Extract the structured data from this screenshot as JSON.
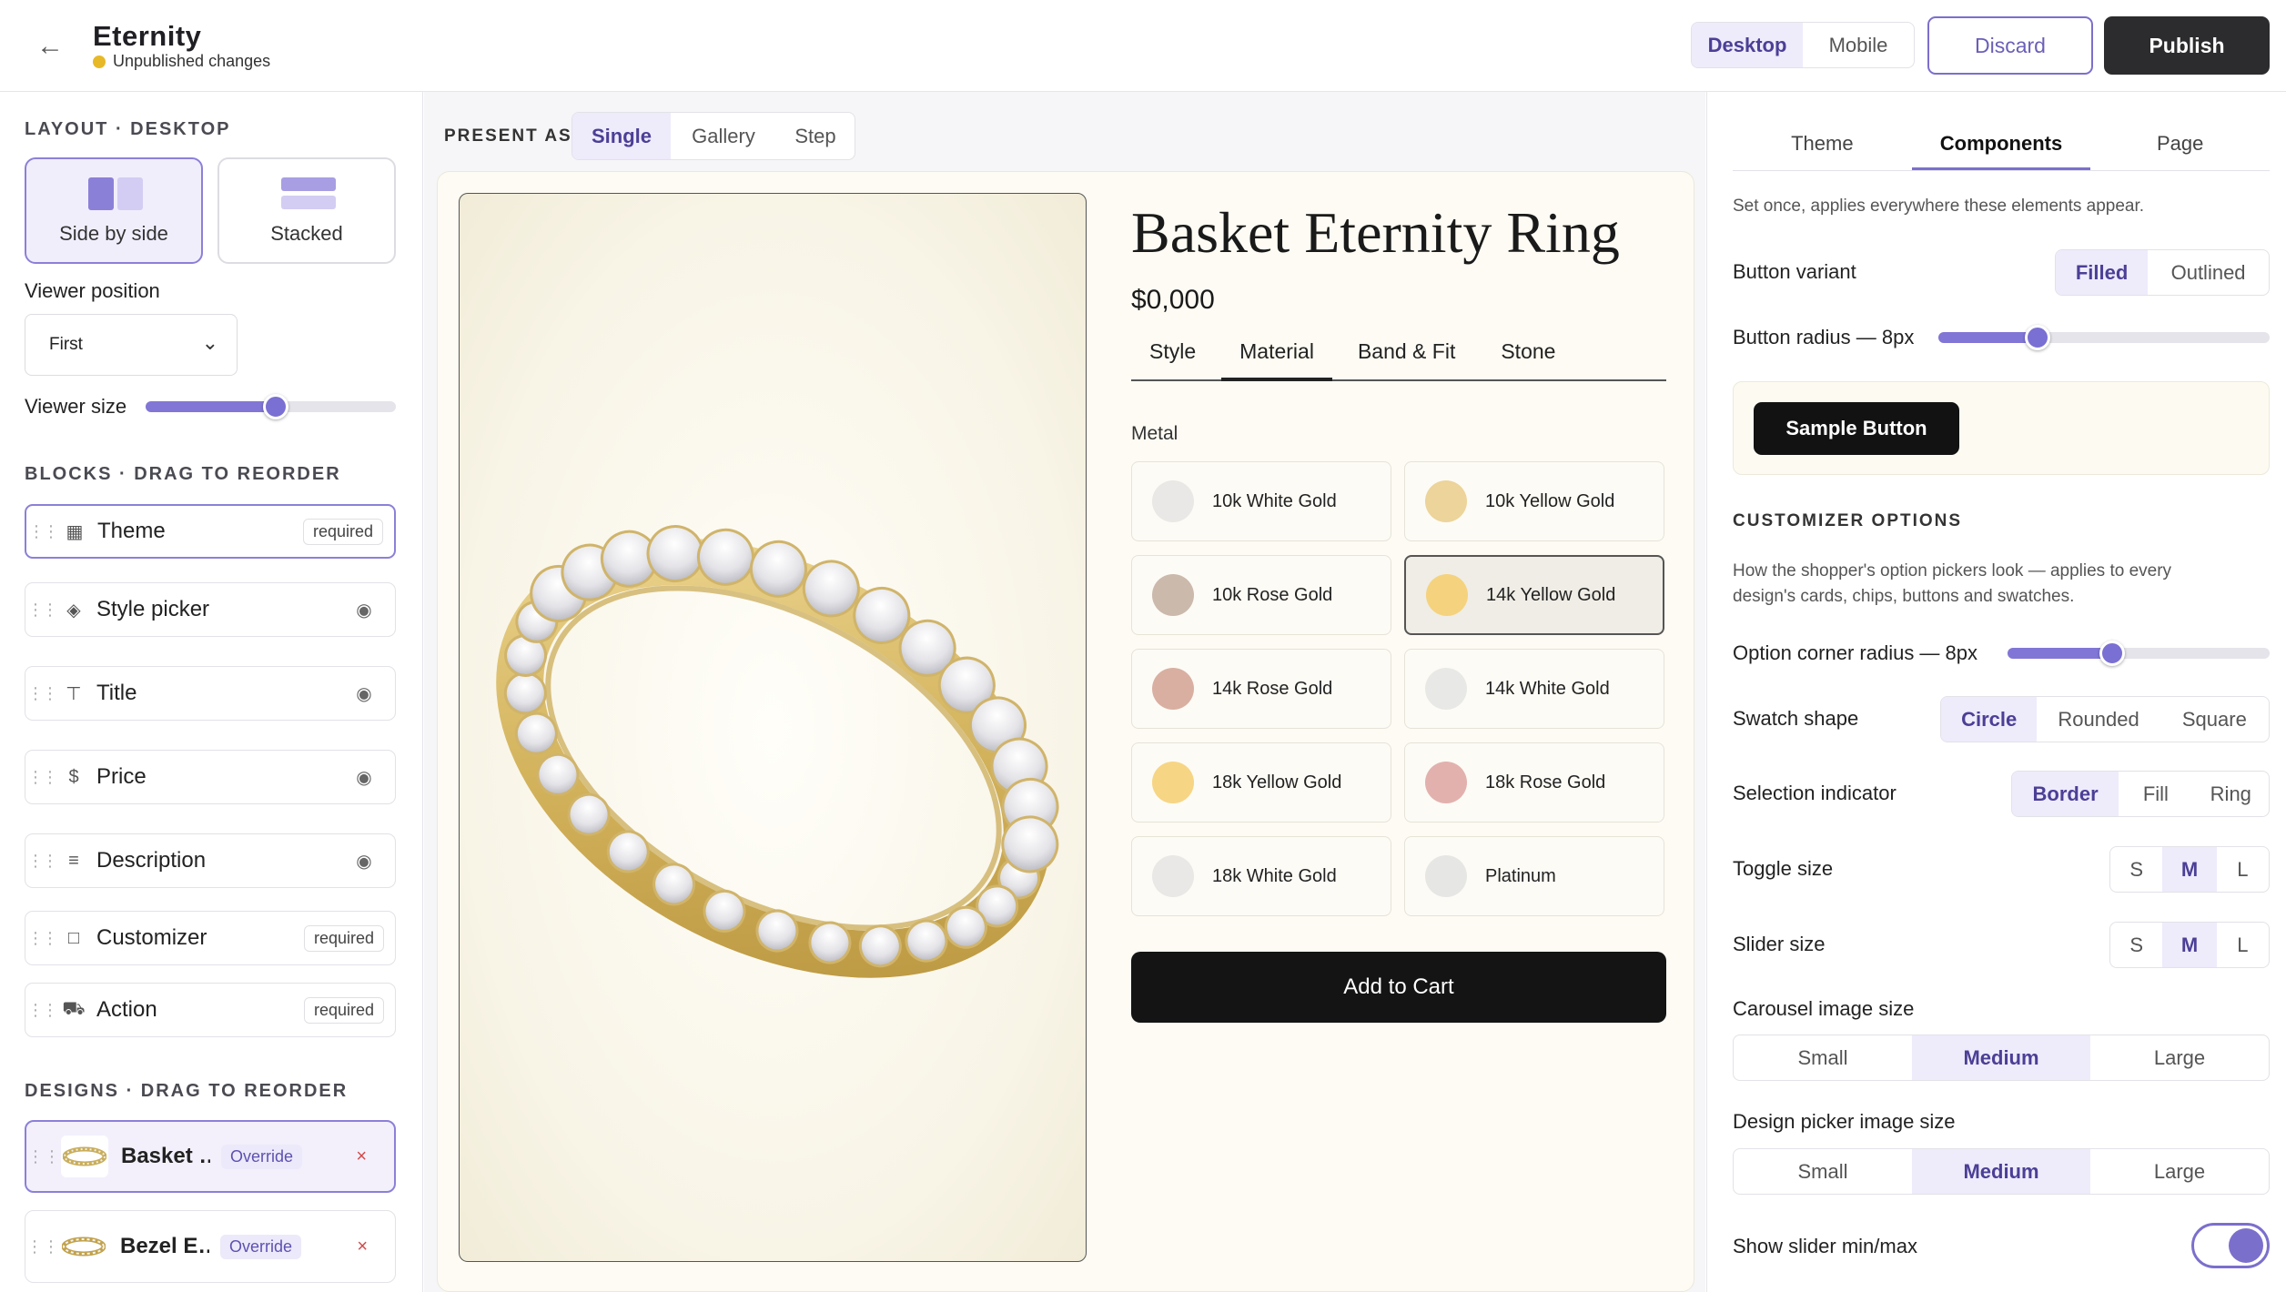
{
  "header": {
    "back_icon": "arrow-left-icon",
    "app_name": "Eternity",
    "status": "Unpublished changes",
    "status_color": "#e7b928",
    "device_tabs": [
      "Desktop",
      "Mobile"
    ],
    "device_active": "Desktop",
    "discard_label": "Discard",
    "publish_label": "Publish"
  },
  "left": {
    "layout_heading": "LAYOUT · DESKTOP",
    "layouts": [
      "Side by side",
      "Stacked"
    ],
    "layout_active": "Side by side",
    "viewer_position_label": "Viewer position",
    "viewer_position_value": "First",
    "viewer_size_label": "Viewer size",
    "viewer_size_level": 0.52,
    "blocks_heading": "BLOCKS · DRAG TO REORDER",
    "blocks": [
      {
        "name": "Theme",
        "icon": "grid-icon",
        "required": "required"
      },
      {
        "name": "Style picker",
        "icon": "layers-icon",
        "eye": "eye-icon"
      },
      {
        "name": "Title",
        "icon": "text-icon",
        "eye": "eye-icon"
      },
      {
        "name": "Price",
        "icon": "dollar-icon",
        "eye": "eye-icon"
      },
      {
        "name": "Description",
        "icon": "lines-icon",
        "eye": "eye-icon"
      },
      {
        "name": "Customizer",
        "icon": "square-icon",
        "required": "required"
      },
      {
        "name": "Action",
        "icon": "cart-icon",
        "required": "required"
      }
    ],
    "designs_heading": "DESIGNS · DRAG TO REORDER",
    "designs": [
      {
        "name": "Basket …",
        "override": "Override",
        "remove": "×"
      },
      {
        "name": "Bezel E…",
        "override": "Override",
        "remove": "×"
      }
    ]
  },
  "center": {
    "present_as_label": "PRESENT AS",
    "present_tabs": [
      "Single",
      "Gallery",
      "Step"
    ],
    "present_active": "Single",
    "product_title": "Basket Eternity Ring",
    "product_price": "$0,000",
    "product_tabs": [
      "Style",
      "Material",
      "Band & Fit",
      "Stone"
    ],
    "product_tab_active": "Material",
    "metal_label": "Metal",
    "metals": [
      {
        "name": "10k White Gold",
        "color": "#e9e8e6"
      },
      {
        "name": "10k Yellow Gold",
        "color": "#ecd49a"
      },
      {
        "name": "10k Rose Gold",
        "color": "#cbb9ac"
      },
      {
        "name": "14k Yellow Gold",
        "color": "#f5d27e"
      },
      {
        "name": "14k Rose Gold",
        "color": "#d9afa2"
      },
      {
        "name": "14k White Gold",
        "color": "#e8e8e6"
      },
      {
        "name": "18k Yellow Gold",
        "color": "#f6d584"
      },
      {
        "name": "18k Rose Gold",
        "color": "#e2b1ae"
      },
      {
        "name": "18k White Gold",
        "color": "#e9e8e6"
      },
      {
        "name": "Platinum",
        "color": "#e6e6e5"
      }
    ],
    "metal_active": "14k Yellow Gold",
    "add_to_cart": "Add to Cart"
  },
  "right": {
    "tabs": [
      "Theme",
      "Components",
      "Page"
    ],
    "tab_active": "Components",
    "intro": "Set once, applies everywhere these elements appear.",
    "button_variant_label": "Button variant",
    "button_variants": [
      "Filled",
      "Outlined"
    ],
    "button_variant_active": "Filled",
    "button_radius_label": "Button radius — 8px",
    "button_radius_level": 0.3,
    "sample_button": "Sample Button",
    "customizer_heading": "CUSTOMIZER OPTIONS",
    "customizer_desc_1": "How the shopper's option pickers look — applies to every",
    "customizer_desc_2": "design's cards, chips, buttons and swatches.",
    "option_radius_label": "Option corner radius — 8px",
    "option_radius_level": 0.4,
    "swatch_shape_label": "Swatch shape",
    "swatch_shapes": [
      "Circle",
      "Rounded",
      "Square"
    ],
    "swatch_shape_active": "Circle",
    "selection_label": "Selection indicator",
    "selection_options": [
      "Border",
      "Fill",
      "Ring"
    ],
    "selection_active": "Border",
    "toggle_size_label": "Toggle size",
    "slider_size_label": "Slider size",
    "sizes": [
      "S",
      "M",
      "L"
    ],
    "toggle_size_active": "M",
    "slider_size_active": "M",
    "carousel_label": "Carousel image size",
    "design_picker_label": "Design picker image size",
    "image_sizes": [
      "Small",
      "Medium",
      "Large"
    ],
    "carousel_active": "Medium",
    "design_picker_active": "Medium",
    "show_minmax_label": "Show slider min/max",
    "show_minmax_on": true,
    "accent": "#7b6fcc"
  }
}
